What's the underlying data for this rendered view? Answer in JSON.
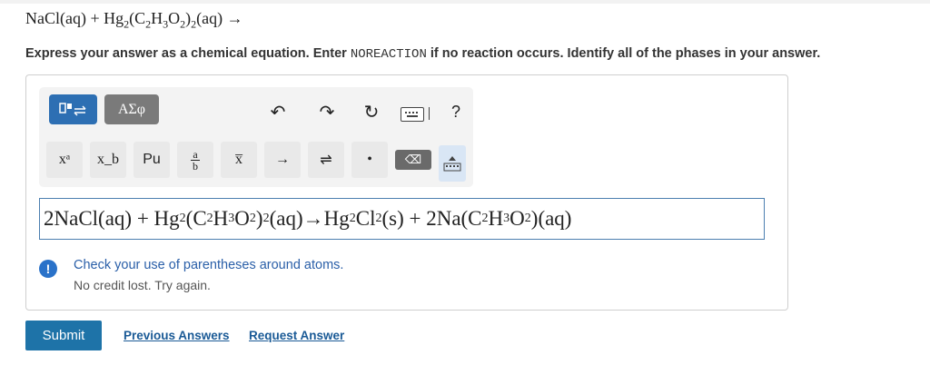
{
  "question": {
    "prefix": "NaCl(aq) + Hg",
    "sub1": "2",
    "mid": "(C",
    "sub2": "2",
    "h": "H",
    "sub3": "3",
    "o": "O",
    "sub4": "2",
    "close": ")",
    "sub5": "2",
    "suffix": "(aq) →"
  },
  "instruction": {
    "before": "Express your answer as a chemical equation. Enter ",
    "code": "NOREACTION",
    "after": " if no reaction occurs. Identify all of the phases in your answer."
  },
  "toolbar": {
    "mode2_label": "ΑΣφ",
    "undo_icon": "↶",
    "redo_icon": "↷",
    "reset_icon": "↻",
    "help_label": "?",
    "keys": {
      "superscript": "xᵃ",
      "subscript": "x_b",
      "element": "Pu",
      "fraction_num": "a",
      "fraction_den": "b",
      "overline": "x̅",
      "arrow": "→",
      "equilibrium": "⇌",
      "dot": "•",
      "delete": "⌫"
    }
  },
  "answer": {
    "p1": "2NaCl(aq) + Hg",
    "s1": "2",
    "p2": "(C",
    "s2": "2",
    "p3": "H",
    "s3": "3",
    "p4": "O",
    "s4": "2",
    "p5": ")",
    "s5": "2",
    "p6": "(aq)→Hg",
    "s6": "2",
    "p7": "Cl",
    "s7": "2",
    "p8": "(s) + 2Na(C",
    "s8": "2",
    "p9": "H",
    "s9": "3",
    "p10": "O",
    "s10": "2",
    "p11": ")(aq)"
  },
  "feedback": {
    "icon": "!",
    "line1": "Check your use of parentheses around atoms.",
    "line2": "No credit lost. Try again."
  },
  "actions": {
    "submit": "Submit",
    "previous": "Previous Answers",
    "request": "Request Answer"
  }
}
